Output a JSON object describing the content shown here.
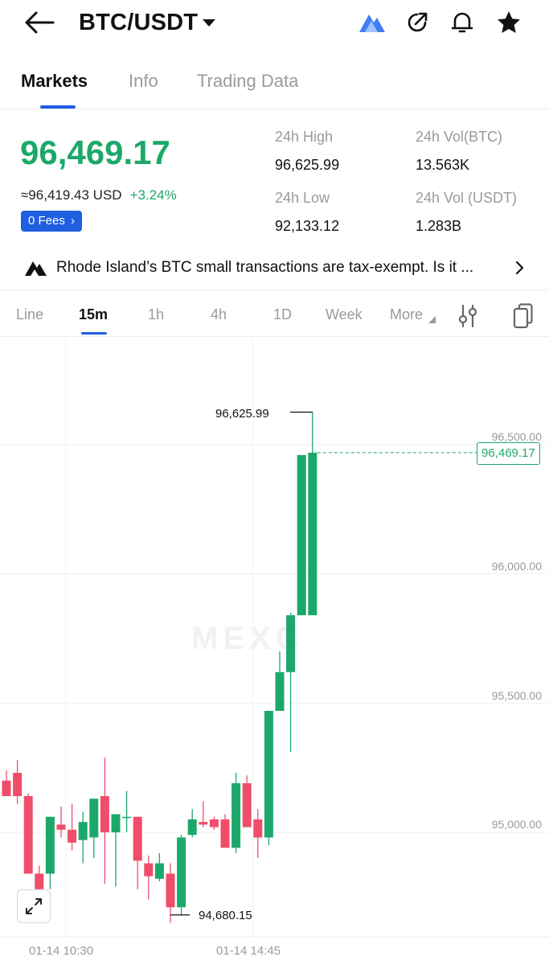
{
  "header": {
    "title": "BTC/USDT",
    "icons": [
      "back-arrow-icon",
      "caret-down-icon",
      "ai-assistant-icon",
      "share-icon",
      "bell-icon",
      "star-icon"
    ],
    "ai_color": "#3f7ff0"
  },
  "tabs": [
    {
      "label": "Markets",
      "active": true
    },
    {
      "label": "Info",
      "active": false
    },
    {
      "label": "Trading Data",
      "active": false
    }
  ],
  "price": {
    "last": "96,469.17",
    "usd": "≈96,419.43 USD",
    "change": "+3.24%",
    "fees_label": "0 Fees",
    "color_up": "#1ca86a",
    "color_down": "#ef4d6a"
  },
  "stats": {
    "high_label": "24h High",
    "high_value": "96,625.99",
    "low_label": "24h Low",
    "low_value": "92,133.12",
    "vol_btc_label": "24h Vol(BTC)",
    "vol_btc_value": "13.563K",
    "vol_usdt_label": "24h Vol (USDT)",
    "vol_usdt_value": "1.283B"
  },
  "news": {
    "text": "Rhode Island’s BTC small transactions are tax-exempt. Is it ...",
    "icon": "ai-news-icon"
  },
  "intervals": [
    {
      "label": "Line",
      "active": false
    },
    {
      "label": "15m",
      "active": true
    },
    {
      "label": "1h",
      "active": false
    },
    {
      "label": "4h",
      "active": false
    },
    {
      "label": "1D",
      "active": false
    },
    {
      "label": "Week",
      "active": false
    },
    {
      "label": "More",
      "active": false
    }
  ],
  "watermark": "MEXC",
  "chart_data": {
    "type": "candlestick",
    "y_ticks": [
      96500,
      96000,
      95500,
      95000
    ],
    "y_tick_labels": [
      "96,500.00",
      "96,000.00",
      "95,500.00",
      "95,000.00"
    ],
    "ylim": [
      94560,
      97000
    ],
    "x_labels": [
      "01-14 10:30",
      "01-14 14:45"
    ],
    "last_price_label": "96,469.17",
    "high_marker_label": "96,625.99",
    "low_marker_label": "94,680.15",
    "high_marker_value": 96625.99,
    "low_marker_value": 94680.15,
    "last_price_value": 96469.17,
    "candles": [
      {
        "o": 95200,
        "h": 95240,
        "l": 95140,
        "c": 95140
      },
      {
        "o": 95230,
        "h": 95280,
        "l": 95110,
        "c": 95140
      },
      {
        "o": 95140,
        "h": 95150,
        "l": 94850,
        "c": 94840
      },
      {
        "o": 94840,
        "h": 94870,
        "l": 94760,
        "c": 94780
      },
      {
        "o": 94840,
        "h": 95060,
        "l": 94780,
        "c": 95060
      },
      {
        "o": 95030,
        "h": 95100,
        "l": 94980,
        "c": 95010
      },
      {
        "o": 95010,
        "h": 95110,
        "l": 94930,
        "c": 94960
      },
      {
        "o": 94970,
        "h": 95080,
        "l": 94880,
        "c": 95040
      },
      {
        "o": 94980,
        "h": 95130,
        "l": 94900,
        "c": 95130
      },
      {
        "o": 95140,
        "h": 95290,
        "l": 94800,
        "c": 95000
      },
      {
        "o": 95000,
        "h": 95070,
        "l": 94790,
        "c": 95070
      },
      {
        "o": 95060,
        "h": 95160,
        "l": 95000,
        "c": 95060
      },
      {
        "o": 95060,
        "h": 95060,
        "l": 94780,
        "c": 94890
      },
      {
        "o": 94880,
        "h": 94910,
        "l": 94740,
        "c": 94830
      },
      {
        "o": 94820,
        "h": 94920,
        "l": 94810,
        "c": 94880
      },
      {
        "o": 94840,
        "h": 94880,
        "l": 94650,
        "c": 94710
      },
      {
        "o": 94710,
        "h": 94990,
        "l": 94680,
        "c": 94980
      },
      {
        "o": 94990,
        "h": 95090,
        "l": 94980,
        "c": 95050
      },
      {
        "o": 95040,
        "h": 95120,
        "l": 95020,
        "c": 95030
      },
      {
        "o": 95050,
        "h": 95060,
        "l": 95010,
        "c": 95020
      },
      {
        "o": 95050,
        "h": 95070,
        "l": 94940,
        "c": 94940
      },
      {
        "o": 94940,
        "h": 95230,
        "l": 94920,
        "c": 95190
      },
      {
        "o": 95190,
        "h": 95220,
        "l": 95020,
        "c": 95020
      },
      {
        "o": 95050,
        "h": 95090,
        "l": 94900,
        "c": 94980
      },
      {
        "o": 94980,
        "h": 95470,
        "l": 94950,
        "c": 95470
      },
      {
        "o": 95470,
        "h": 95700,
        "l": 95470,
        "c": 95620
      },
      {
        "o": 95620,
        "h": 95850,
        "l": 95310,
        "c": 95840
      },
      {
        "o": 95840,
        "h": 96030,
        "l": 95840,
        "c": 96460
      },
      {
        "o": 95840,
        "h": 96626,
        "l": 95840,
        "c": 96469
      }
    ]
  }
}
